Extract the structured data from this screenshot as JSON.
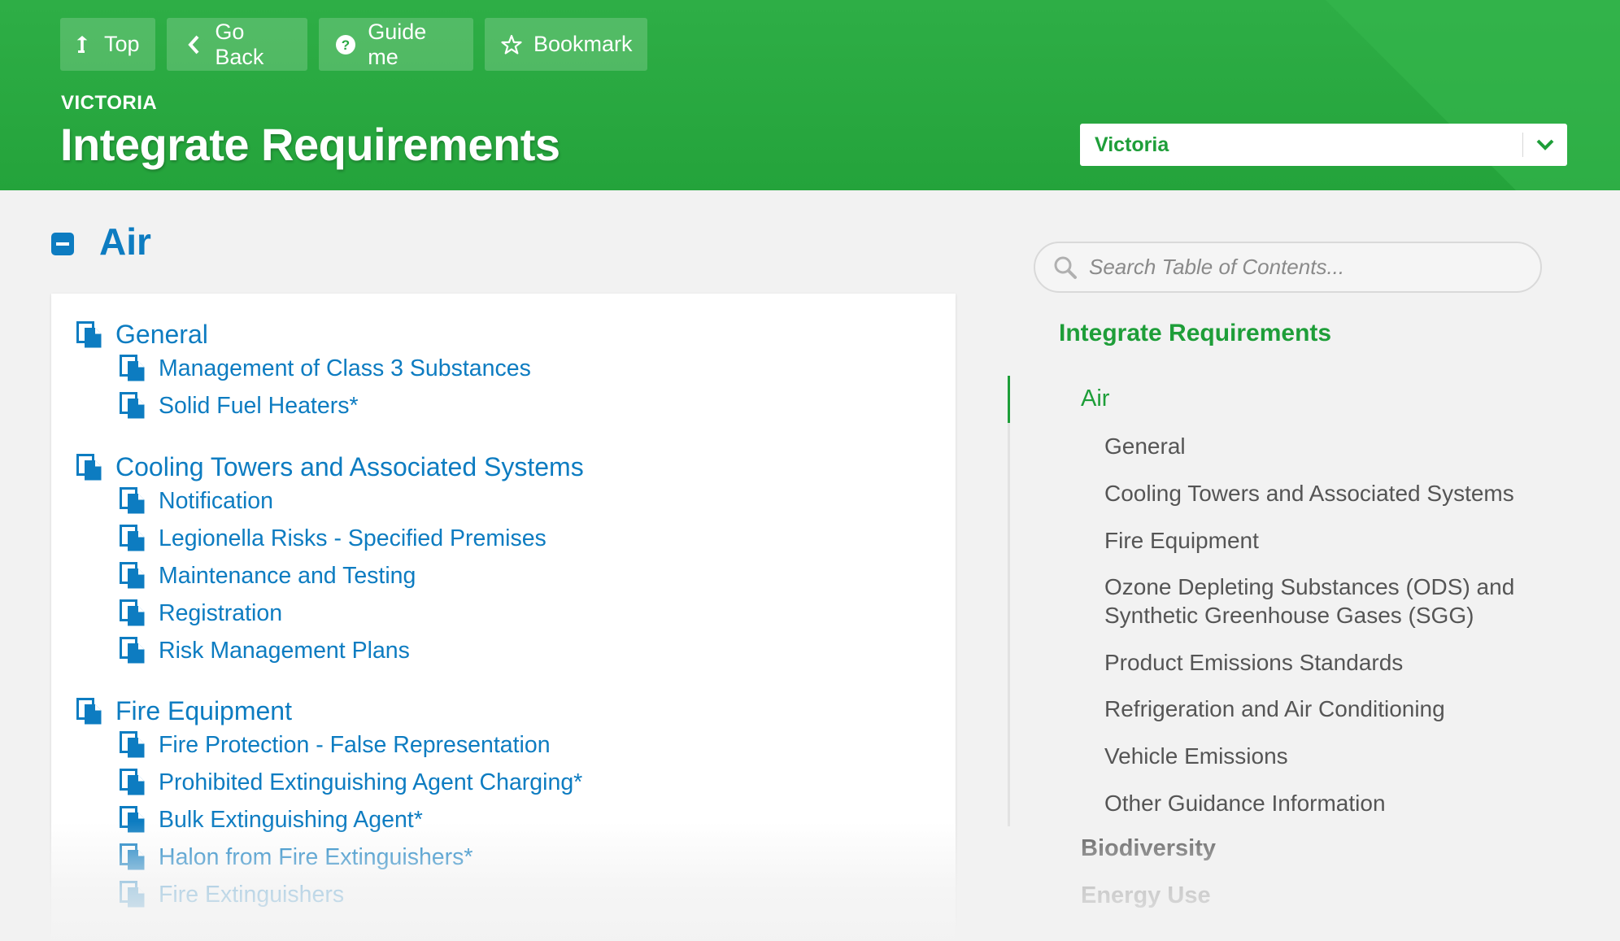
{
  "toolbar": {
    "top_label": "Top",
    "back_label": "Go Back",
    "guide_label": "Guide me",
    "bookmark_label": "Bookmark"
  },
  "header": {
    "eyebrow": "VICTORIA",
    "title": "Integrate Requirements",
    "state_select": {
      "value": "Victoria"
    }
  },
  "section": {
    "title": "Air"
  },
  "content": {
    "groups": [
      {
        "title": "General",
        "items": [
          "Management of Class 3 Substances",
          "Solid Fuel Heaters*"
        ]
      },
      {
        "title": "Cooling Towers and Associated Systems",
        "items": [
          "Notification",
          "Legionella Risks - Specified Premises",
          "Maintenance and Testing",
          "Registration",
          "Risk Management Plans"
        ]
      },
      {
        "title": "Fire Equipment",
        "items": [
          "Fire Protection - False Representation",
          "Prohibited Extinguishing Agent Charging*",
          "Bulk Extinguishing Agent*",
          "Halon from Fire Extinguishers*",
          "Fire Extinguishers"
        ]
      }
    ]
  },
  "sidebar": {
    "search_placeholder": "Search Table of Contents...",
    "root": "Integrate Requirements",
    "active": "Air",
    "sub_items": [
      "General",
      "Cooling Towers and Associated Systems",
      "Fire Equipment",
      "Ozone Depleting Substances (ODS) and Synthetic Greenhouse Gases (SGG)",
      "Product Emissions Standards",
      "Refrigeration and Air Conditioning",
      "Vehicle Emissions",
      "Other Guidance Information"
    ],
    "siblings": [
      "Biodiversity",
      "Energy Use"
    ]
  },
  "colors": {
    "header_green": "#2eae46",
    "link_blue": "#0d7cc1",
    "active_green": "#1e9e39",
    "sidebar_text": "#555555"
  }
}
